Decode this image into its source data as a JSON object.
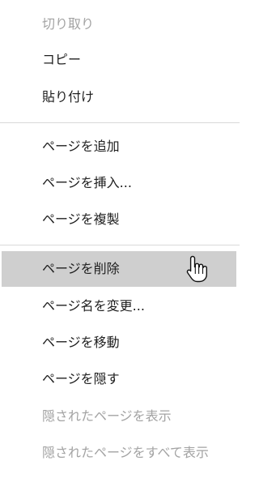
{
  "menu": {
    "items": [
      {
        "label": "切り取り",
        "enabled": false
      },
      {
        "label": "コピー",
        "enabled": true
      },
      {
        "label": "貼り付け",
        "enabled": true
      },
      {
        "label": "ページを追加",
        "enabled": true
      },
      {
        "label": "ページを挿入...",
        "enabled": true
      },
      {
        "label": "ページを複製",
        "enabled": true
      },
      {
        "label": "ページを削除",
        "enabled": true,
        "hovered": true
      },
      {
        "label": "ページ名を変更...",
        "enabled": true
      },
      {
        "label": "ページを移動",
        "enabled": true
      },
      {
        "label": "ページを隠す",
        "enabled": true
      },
      {
        "label": "隠されたページを表示",
        "enabled": false
      },
      {
        "label": "隠されたページをすべて表示",
        "enabled": false
      }
    ]
  },
  "cursor": {
    "icon": "hand-pointer-icon"
  },
  "colors": {
    "text": "#1f1f1f",
    "disabled_text": "#a3a3a3",
    "hover_background": "#cfcfcf",
    "separator": "#d9d9d9"
  }
}
